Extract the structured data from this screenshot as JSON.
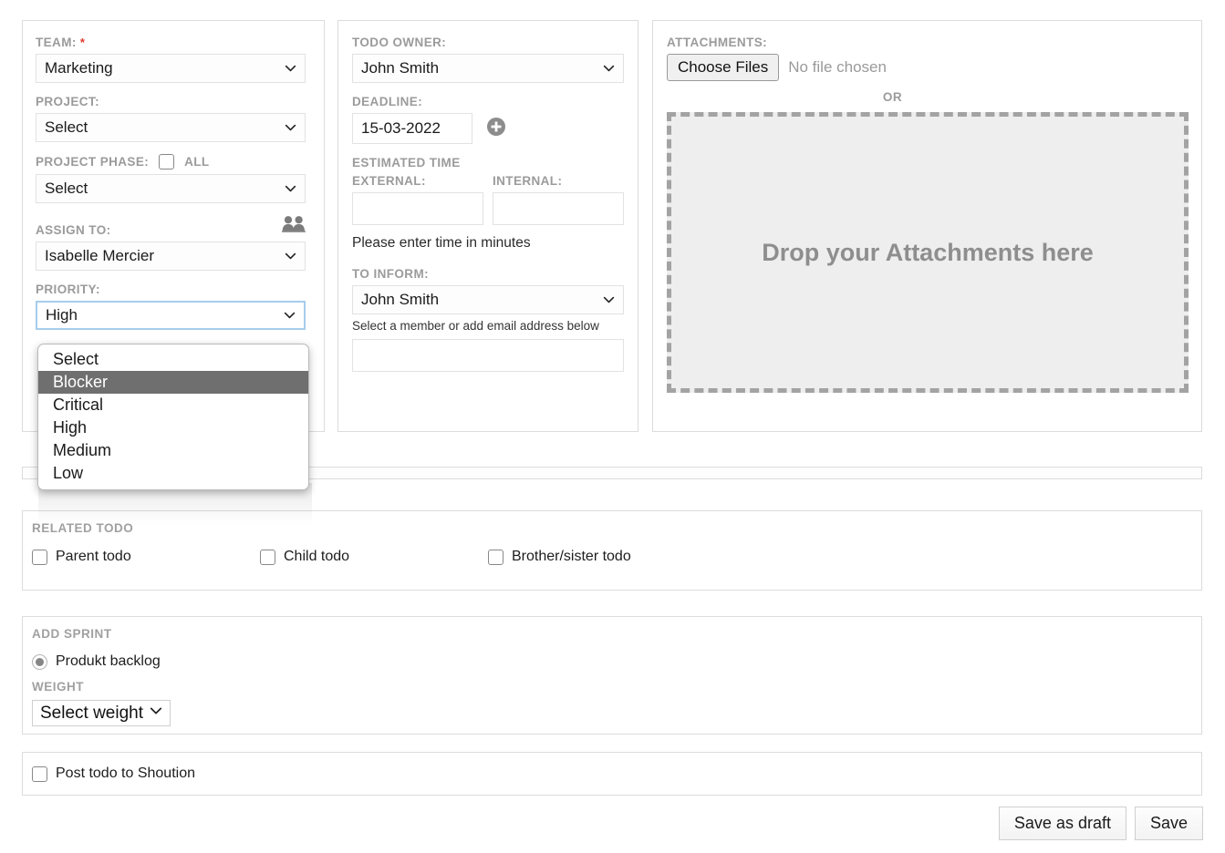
{
  "left_panel": {
    "team": {
      "label": "TEAM:",
      "required_mark": "*",
      "value": "Marketing"
    },
    "project": {
      "label": "PROJECT:",
      "value": "Select"
    },
    "project_phase": {
      "label": "PROJECT PHASE:",
      "all_label": "ALL",
      "value": "Select"
    },
    "assign_to": {
      "label": "ASSIGN TO:",
      "value": "Isabelle Mercier",
      "icon": "group-users-icon"
    },
    "priority": {
      "label": "PRIORITY:",
      "value": "High",
      "options": [
        "Select",
        "Blocker",
        "Critical",
        "High",
        "Medium",
        "Low"
      ],
      "highlighted_option": "Blocker"
    }
  },
  "middle_panel": {
    "todo_owner": {
      "label": "TODO OWNER:",
      "value": "John Smith"
    },
    "deadline": {
      "label": "DEADLINE:",
      "value": "15-03-2022",
      "add_icon": "plus-circle-icon"
    },
    "estimated_time": {
      "label": "ESTIMATED TIME",
      "external_label": "EXTERNAL:",
      "external_value": "",
      "internal_label": "INTERNAL:",
      "internal_value": "",
      "hint": "Please enter time in minutes"
    },
    "to_inform": {
      "label": "TO INFORM:",
      "value": "John Smith",
      "hint": "Select a member or add email address below",
      "email_value": ""
    }
  },
  "right_panel": {
    "attachments_label": "ATTACHMENTS:",
    "choose_files_button": "Choose Files",
    "no_file_chosen": "No file chosen",
    "or_label": "OR",
    "dropzone_text": "Drop your Attachments here"
  },
  "related_todo": {
    "title": "RELATED TODO",
    "options": [
      {
        "label": "Parent todo",
        "checked": false
      },
      {
        "label": "Child todo",
        "checked": false
      },
      {
        "label": "Brother/sister todo",
        "checked": false
      }
    ]
  },
  "add_sprint": {
    "title": "ADD SPRINT",
    "radio_label": "Produkt backlog",
    "radio_selected": true,
    "weight_label": "WEIGHT",
    "weight_value": "Select weight"
  },
  "shoution": {
    "label": "Post todo to Shoution",
    "checked": false
  },
  "footer": {
    "save_draft_button": "Save as draft",
    "save_button": "Save"
  },
  "colors": {
    "panel_border": "#dcdcdc",
    "label_gray": "#9b9b9b",
    "focus_border": "#a6ccec",
    "option_highlight": "#6f6f6f",
    "required_red": "#e03b30",
    "dropzone_border": "#a3a3a3",
    "dropzone_bg": "#eeeeee"
  }
}
